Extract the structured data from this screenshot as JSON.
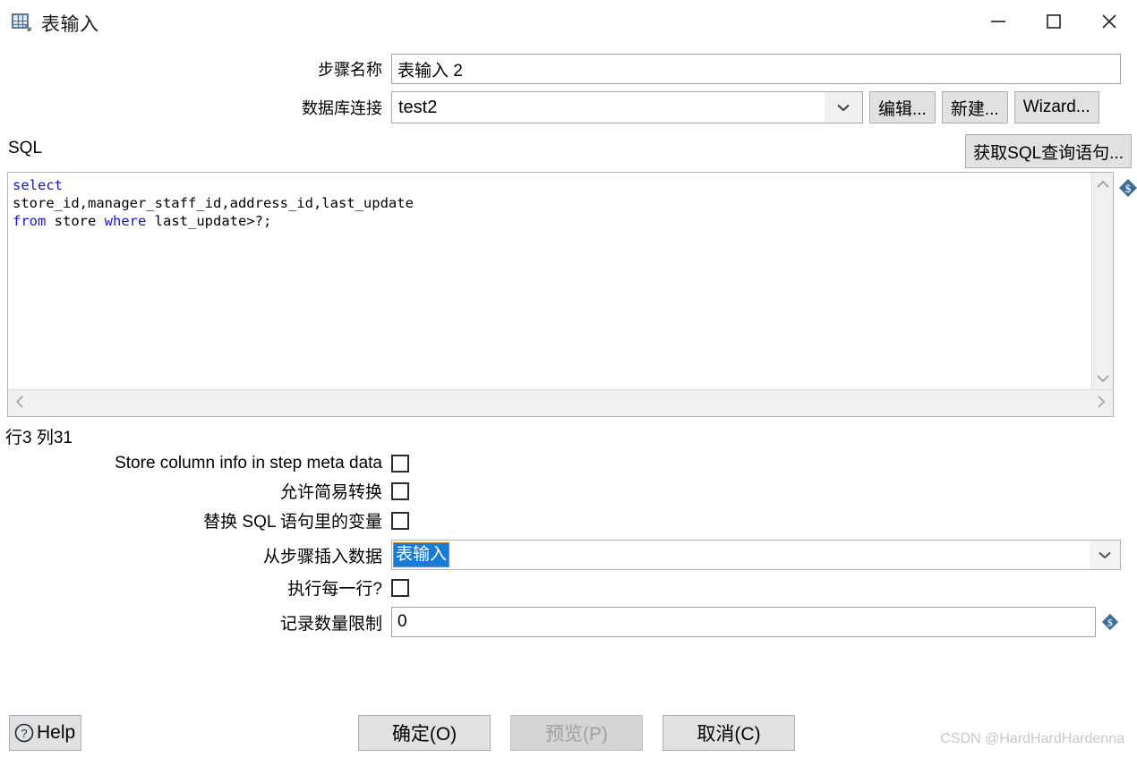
{
  "window": {
    "title": "表输入",
    "icon": "table-input-icon",
    "controls": {
      "minimize": "minimize-icon",
      "maximize": "maximize-icon",
      "close": "close-icon"
    }
  },
  "form": {
    "step_name_label": "步骤名称",
    "step_name_value": "表输入 2",
    "connection_label": "数据库连接",
    "connection_value": "test2",
    "edit_button": "编辑...",
    "new_button": "新建...",
    "wizard_button": "Wizard..."
  },
  "sql": {
    "label": "SQL",
    "get_sql_button": "获取SQL查询语句...",
    "tokens": [
      {
        "text": "select",
        "kind": "keyword"
      },
      {
        "text": "\n",
        "kind": "plain"
      },
      {
        "text": "store_id,manager_staff_id,address_id,last_update\n",
        "kind": "plain"
      },
      {
        "text": "from",
        "kind": "keyword"
      },
      {
        "text": " store ",
        "kind": "plain"
      },
      {
        "text": "where",
        "kind": "keyword"
      },
      {
        "text": " last_update>?;",
        "kind": "plain"
      }
    ],
    "scroll_up_icon": "chevron-up-icon",
    "scroll_down_icon": "chevron-down-icon",
    "scroll_left_icon": "chevron-left-icon",
    "scroll_right_icon": "chevron-right-icon",
    "variable_icon": "dollar-variable-icon",
    "position_label": "行3 列31"
  },
  "options": {
    "store_column_info": {
      "label": "Store column info in step meta data",
      "checked": false
    },
    "allow_lazy": {
      "label": "允许简易转换",
      "checked": false
    },
    "replace_vars": {
      "label": "替换 SQL 语句里的变量",
      "checked": false
    },
    "insert_from_step": {
      "label": "从步骤插入数据",
      "value": "表输入"
    },
    "execute_each_row": {
      "label": "执行每一行?",
      "checked": false
    },
    "row_limit": {
      "label": "记录数量限制",
      "value": "0"
    }
  },
  "footer": {
    "help_label": "Help",
    "help_icon": "question-circle-icon",
    "ok_label": "确定(O)",
    "preview_label": "预览(P)",
    "cancel_label": "取消(C)",
    "preview_disabled": true
  },
  "watermark": "CSDN @HardHardHardenna",
  "colors": {
    "keyword": "#1515c8",
    "selection": "#1a7bd4",
    "button_face": "#e1e1e1",
    "disabled_text": "#a0a0a0"
  }
}
